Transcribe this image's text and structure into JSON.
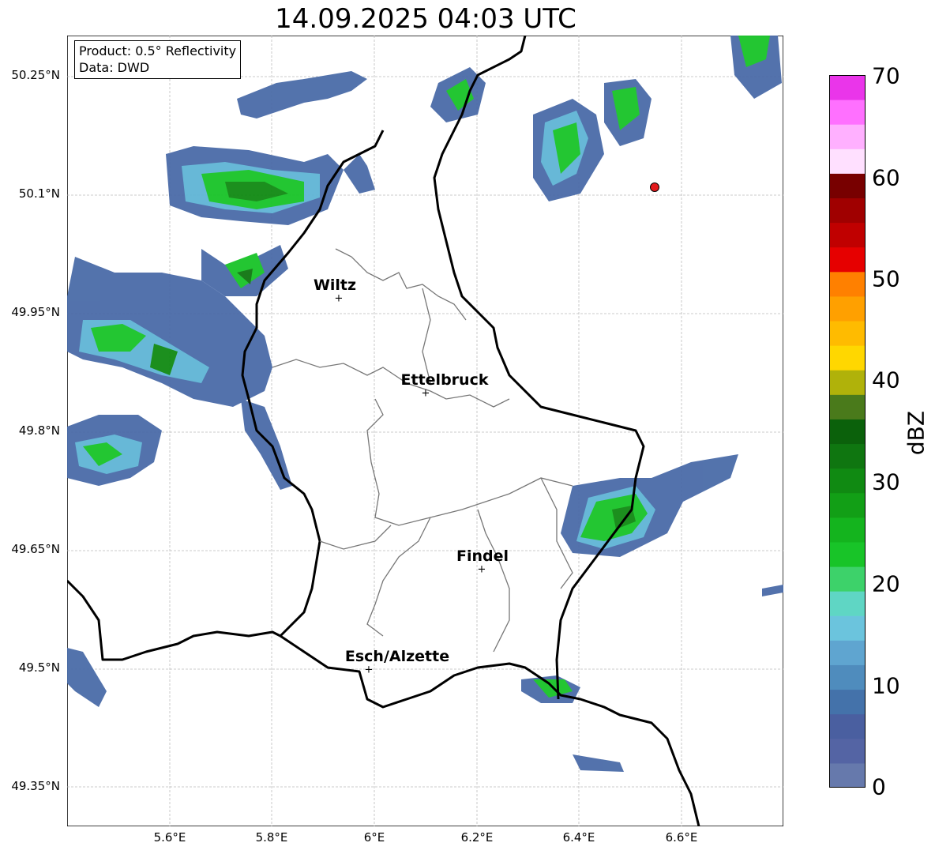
{
  "title": "14.09.2025 04:03 UTC",
  "info": {
    "product": "Product: 0.5° Reflectivity",
    "data": "Data: DWD"
  },
  "axes": {
    "lat_ticks": [
      "50.25°N",
      "50.1°N",
      "49.95°N",
      "49.8°N",
      "49.65°N",
      "49.5°N",
      "49.35°N"
    ],
    "lon_ticks": [
      "5.6°E",
      "5.8°E",
      "6°E",
      "6.2°E",
      "6.4°E",
      "6.6°E"
    ]
  },
  "cities": [
    {
      "name": "Wiltz",
      "lon": 5.93,
      "lat": 49.97
    },
    {
      "name": "Ettelbruck",
      "lon": 6.1,
      "lat": 49.85
    },
    {
      "name": "Findel",
      "lon": 6.21,
      "lat": 49.63
    },
    {
      "name": "Esch/Alzette",
      "lon": 5.99,
      "lat": 49.5
    }
  ],
  "radar_site_marker": {
    "lon": 6.55,
    "lat": 50.11,
    "color": "#e31a1c"
  },
  "colorbar": {
    "label": "dBZ",
    "ticks": [
      "0",
      "10",
      "20",
      "30",
      "40",
      "50",
      "60",
      "70"
    ],
    "colors": [
      "#6679ac",
      "#5464a4",
      "#4a5fa0",
      "#4472aa",
      "#4f8cbd",
      "#5fa5d0",
      "#6bc4dd",
      "#5fd6c4",
      "#3dd26a",
      "#18c428",
      "#14b41e",
      "#129f16",
      "#108a12",
      "#0f7610",
      "#0b610b",
      "#4a7a1b",
      "#b0b20a",
      "#ffd700",
      "#ffbb00",
      "#ffa000",
      "#ff8000",
      "#e60000",
      "#c00000",
      "#a00000",
      "#780000",
      "#ffe0ff",
      "#ffb0ff",
      "#ff70ff",
      "#ea35ea"
    ]
  }
}
